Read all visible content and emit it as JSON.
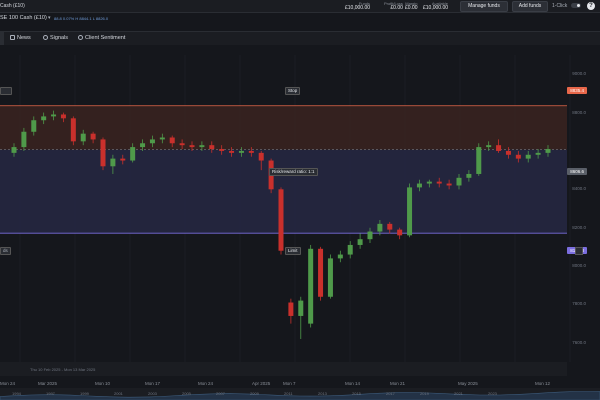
{
  "topbar": {
    "instrument_title": "Cash (£10)",
    "stats": [
      {
        "label": "Funds",
        "value": "£10,000.00"
      },
      {
        "label": "Profit/Loss",
        "value": "£0.00"
      },
      {
        "label": "Margin",
        "value": "£0.00"
      },
      {
        "label": "Available",
        "value": "£10,000.00"
      }
    ],
    "manage_funds_label": "Manage funds",
    "add_funds_label": "Add funds",
    "one_click_label": "1-Click",
    "help_label": "?"
  },
  "subbar": {
    "instrument_name": "SE 100 Cash (£10)",
    "quote_line": "88.8 0.07% H 8844.1 L 8826.0"
  },
  "tabs": [
    {
      "label": "News",
      "icon": "news-icon"
    },
    {
      "label": "Signals",
      "icon": "signals-icon"
    },
    {
      "label": "Client Sentiment",
      "icon": "sentiment-icon"
    }
  ],
  "chart": {
    "stop_label": "Stop",
    "stop_price": "8835.4",
    "risk_reward_label": "Risk/reward ratio: 1:1",
    "current_price": "8606.6",
    "limit_label": "Limit",
    "limit_price": "8171.3",
    "left_tag_top": "",
    "left_tag_bottom": "ds",
    "info_line": "Thu 10 Feb 2025 - Mon 13 Mar 2025",
    "y_ticks": [
      "9000.0",
      "8800.0",
      "8400.0",
      "8200.0",
      "8000.0",
      "7800.0",
      "7600.0"
    ],
    "x_labels": [
      "Mon 24",
      "Mar 2025",
      "Mon 10",
      "Mon 17",
      "Mon 24",
      "Apr 2025",
      "Mon 7",
      "Mon 14",
      "Mon 21",
      "May 2025",
      "Mon 12"
    ],
    "timeline_labels": [
      "1994",
      "1997",
      "1999",
      "2001",
      "2003",
      "2005",
      "2007",
      "2009",
      "2011",
      "2013",
      "2015",
      "2017",
      "2019",
      "2021",
      "2023"
    ],
    "colors": {
      "up": "#4f9a4a",
      "down": "#c9302c",
      "stop": "#e8674a",
      "limit": "#7b6ee0"
    }
  },
  "chart_data": {
    "type": "candlestick",
    "ylim": [
      7500,
      9100
    ],
    "candles": [
      {
        "o": 8590,
        "c": 8620,
        "h": 8640,
        "l": 8570
      },
      {
        "o": 8620,
        "c": 8700,
        "h": 8720,
        "l": 8600
      },
      {
        "o": 8700,
        "c": 8760,
        "h": 8780,
        "l": 8680
      },
      {
        "o": 8760,
        "c": 8780,
        "h": 8800,
        "l": 8740
      },
      {
        "o": 8780,
        "c": 8790,
        "h": 8810,
        "l": 8760
      },
      {
        "o": 8790,
        "c": 8770,
        "h": 8800,
        "l": 8750
      },
      {
        "o": 8770,
        "c": 8650,
        "h": 8780,
        "l": 8630
      },
      {
        "o": 8650,
        "c": 8690,
        "h": 8710,
        "l": 8630
      },
      {
        "o": 8690,
        "c": 8660,
        "h": 8700,
        "l": 8640
      },
      {
        "o": 8660,
        "c": 8520,
        "h": 8670,
        "l": 8500
      },
      {
        "o": 8520,
        "c": 8560,
        "h": 8580,
        "l": 8480
      },
      {
        "o": 8560,
        "c": 8550,
        "h": 8580,
        "l": 8530
      },
      {
        "o": 8550,
        "c": 8620,
        "h": 8640,
        "l": 8540
      },
      {
        "o": 8620,
        "c": 8640,
        "h": 8660,
        "l": 8600
      },
      {
        "o": 8640,
        "c": 8660,
        "h": 8680,
        "l": 8620
      },
      {
        "o": 8660,
        "c": 8670,
        "h": 8690,
        "l": 8640
      },
      {
        "o": 8670,
        "c": 8640,
        "h": 8680,
        "l": 8620
      },
      {
        "o": 8640,
        "c": 8630,
        "h": 8660,
        "l": 8610
      },
      {
        "o": 8630,
        "c": 8620,
        "h": 8650,
        "l": 8600
      },
      {
        "o": 8620,
        "c": 8630,
        "h": 8650,
        "l": 8600
      },
      {
        "o": 8630,
        "c": 8610,
        "h": 8650,
        "l": 8590
      },
      {
        "o": 8610,
        "c": 8600,
        "h": 8630,
        "l": 8580
      },
      {
        "o": 8600,
        "c": 8590,
        "h": 8620,
        "l": 8570
      },
      {
        "o": 8590,
        "c": 8600,
        "h": 8620,
        "l": 8570
      },
      {
        "o": 8600,
        "c": 8590,
        "h": 8620,
        "l": 8570
      },
      {
        "o": 8590,
        "c": 8550,
        "h": 8600,
        "l": 8500
      },
      {
        "o": 8550,
        "c": 8400,
        "h": 8560,
        "l": 8380
      },
      {
        "o": 8400,
        "c": 8080,
        "h": 8410,
        "l": 8060
      },
      {
        "o": 7810,
        "c": 7740,
        "h": 7830,
        "l": 7700
      },
      {
        "o": 7740,
        "c": 7820,
        "h": 7840,
        "l": 7620
      },
      {
        "o": 7700,
        "c": 8090,
        "h": 8110,
        "l": 7680
      },
      {
        "o": 8090,
        "c": 7840,
        "h": 8100,
        "l": 7820
      },
      {
        "o": 7840,
        "c": 8040,
        "h": 8060,
        "l": 7830
      },
      {
        "o": 8040,
        "c": 8060,
        "h": 8080,
        "l": 8020
      },
      {
        "o": 8060,
        "c": 8110,
        "h": 8130,
        "l": 8040
      },
      {
        "o": 8110,
        "c": 8140,
        "h": 8170,
        "l": 8090
      },
      {
        "o": 8140,
        "c": 8180,
        "h": 8200,
        "l": 8120
      },
      {
        "o": 8180,
        "c": 8220,
        "h": 8240,
        "l": 8160
      },
      {
        "o": 8220,
        "c": 8190,
        "h": 8230,
        "l": 8170
      },
      {
        "o": 8190,
        "c": 8160,
        "h": 8200,
        "l": 8140
      },
      {
        "o": 8160,
        "c": 8410,
        "h": 8430,
        "l": 8150
      },
      {
        "o": 8410,
        "c": 8430,
        "h": 8450,
        "l": 8390
      },
      {
        "o": 8430,
        "c": 8440,
        "h": 8450,
        "l": 8410
      },
      {
        "o": 8440,
        "c": 8430,
        "h": 8460,
        "l": 8410
      },
      {
        "o": 8430,
        "c": 8420,
        "h": 8450,
        "l": 8400
      },
      {
        "o": 8420,
        "c": 8460,
        "h": 8480,
        "l": 8400
      },
      {
        "o": 8460,
        "c": 8480,
        "h": 8500,
        "l": 8440
      },
      {
        "o": 8480,
        "c": 8620,
        "h": 8640,
        "l": 8470
      },
      {
        "o": 8620,
        "c": 8630,
        "h": 8650,
        "l": 8600
      },
      {
        "o": 8630,
        "c": 8600,
        "h": 8660,
        "l": 8590
      },
      {
        "o": 8600,
        "c": 8580,
        "h": 8620,
        "l": 8560
      },
      {
        "o": 8580,
        "c": 8560,
        "h": 8600,
        "l": 8540
      },
      {
        "o": 8560,
        "c": 8580,
        "h": 8600,
        "l": 8540
      },
      {
        "o": 8580,
        "c": 8590,
        "h": 8610,
        "l": 8560
      },
      {
        "o": 8590,
        "c": 8610,
        "h": 8630,
        "l": 8570
      }
    ],
    "stop_level": 8835.4,
    "current_level": 8606.6,
    "limit_level": 8171.3
  }
}
